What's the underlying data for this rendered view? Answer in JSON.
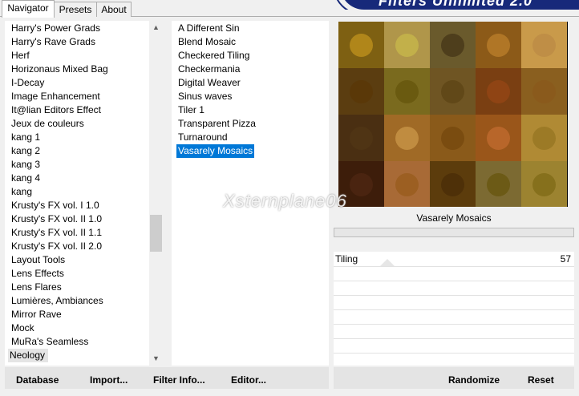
{
  "tabs": [
    "Navigator",
    "Presets",
    "About"
  ],
  "banner_title": "Filters Unlimited 2.0",
  "categories": [
    "Harry's Power Grads",
    "Harry's Rave Grads",
    "Herf",
    "Horizonaus Mixed Bag",
    "I-Decay",
    "Image Enhancement",
    "It@lian Editors Effect",
    "Jeux de couleurs",
    "kang 1",
    "kang 2",
    "kang 3",
    "kang 4",
    "kang",
    "Krusty's FX vol. I 1.0",
    "Krusty's FX vol. II 1.0",
    "Krusty's FX vol. II 1.1",
    "Krusty's FX vol. II 2.0",
    "Layout Tools",
    "Lens Effects",
    "Lens Flares",
    "Lumières, Ambiances",
    "Mirror Rave",
    "Mock",
    "MuRa's Seamless",
    "Neology"
  ],
  "selected_category": "Neology",
  "filters": [
    "A Different Sin",
    "Blend Mosaic",
    "Checkered Tiling",
    "Checkermania",
    "Digital Weaver",
    "Sinus waves",
    "Tiler 1",
    "Transparent Pizza",
    "Turnaround",
    "Vasarely Mosaics"
  ],
  "selected_filter": "Vasarely Mosaics",
  "preview": {
    "filter_name": "Vasarely Mosaics",
    "watermark": "Xsternplane06",
    "tiles": [
      [
        "#7e6012",
        "#b0964a",
        "#6a5a2c",
        "#8c5a18",
        "#c99a4a"
      ],
      [
        "#5b3d10",
        "#7a6a1e",
        "#6f5523",
        "#7a3f12",
        "#8a5f1f"
      ],
      [
        "#4a2f12",
        "#a06a26",
        "#8a5a1a",
        "#9a561a",
        "#b08a34"
      ],
      [
        "#3d1d0a",
        "#a86a36",
        "#5c3c0c",
        "#7c6a32",
        "#9c8330"
      ]
    ],
    "dots": [
      [
        "#b0861a",
        "#c2b04a",
        "#4e3e1c",
        "#b07626",
        "#bf8e46"
      ],
      [
        "#5a3808",
        "#6a5a10",
        "#614818",
        "#8f4414",
        "#8a5a1c"
      ],
      [
        "#4f3414",
        "#c08c40",
        "#7a4c10",
        "#b8662a",
        "#9c7a26"
      ],
      [
        "#4a2410",
        "#9c5f22",
        "#4e3008",
        "#6c5a16",
        "#86701c"
      ]
    ]
  },
  "parameters": [
    {
      "label": "Tiling",
      "value": "57"
    }
  ],
  "buttons": {
    "database": "Database",
    "import": "Import...",
    "filter_info": "Filter Info...",
    "editor": "Editor...",
    "randomize": "Randomize",
    "reset": "Reset"
  },
  "icons": {
    "scroll_up": "chevron-up-icon",
    "scroll_down": "chevron-down-icon"
  }
}
